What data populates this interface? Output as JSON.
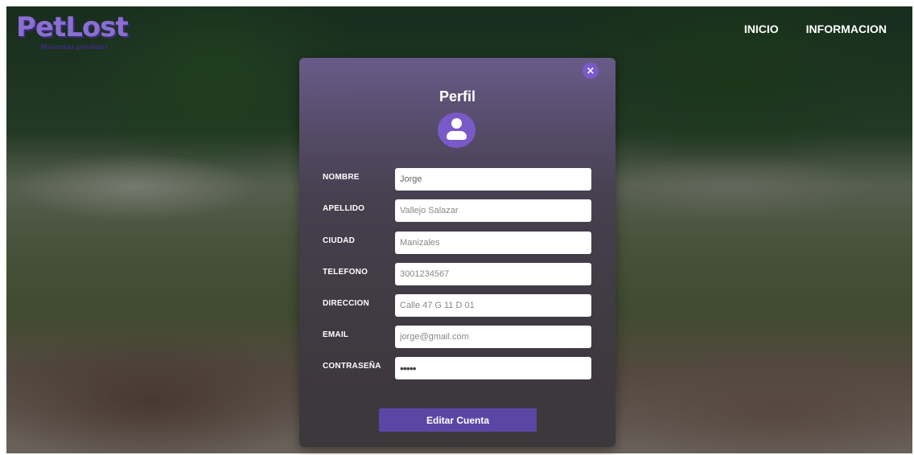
{
  "brand": {
    "logo_text": "PetLost",
    "tagline": "Mascotas perdidas"
  },
  "nav": {
    "items": [
      "INICIO",
      "INFORMACION"
    ]
  },
  "modal": {
    "close_glyph": "×",
    "title": "Perfil",
    "avatar_icon": "user-icon",
    "fields": [
      {
        "label": "NOMBRE",
        "value": "Jorge"
      },
      {
        "label": "APELLIDO",
        "value": "Vallejo Salazar"
      },
      {
        "label": "CIUDAD",
        "value": "Manizales"
      },
      {
        "label": "TELEFONO",
        "value": "3001234567"
      },
      {
        "label": "DIRECCION",
        "value": "Calle 47 G 11 D 01"
      },
      {
        "label": "EMAIL",
        "value": "jorge@gmail.com"
      },
      {
        "label": "CONTRASEÑA",
        "value": "•••••"
      }
    ],
    "submit_label": "Editar Cuenta"
  },
  "colors": {
    "accent": "#7a5ac9",
    "button": "#5b46a6"
  }
}
